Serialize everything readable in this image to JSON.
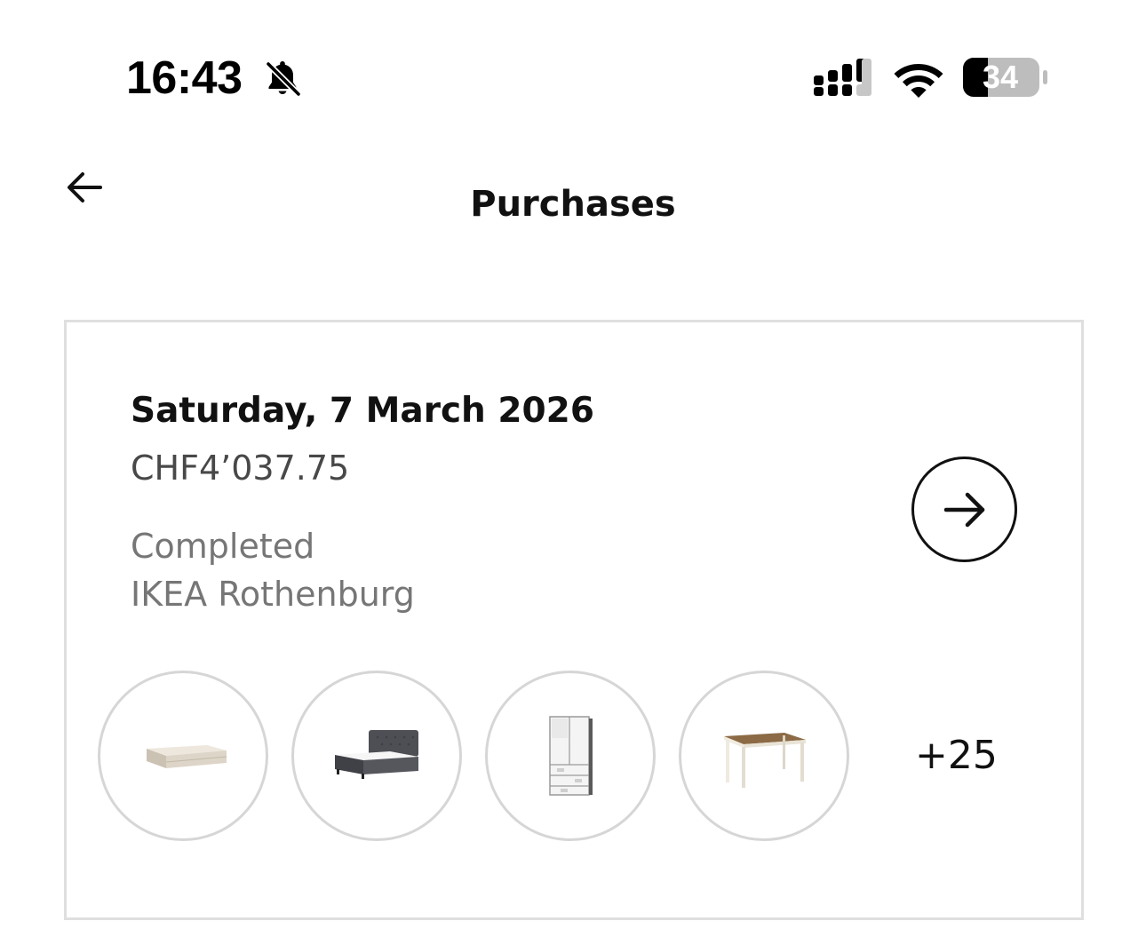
{
  "status_bar": {
    "time": "16:43",
    "silent_icon": "bell-slash-icon",
    "signal_icon": "cellular-signal-icon",
    "wifi_icon": "wifi-icon",
    "battery_level": "34"
  },
  "header": {
    "back_icon": "arrow-left-icon",
    "title": "Purchases"
  },
  "purchases": [
    {
      "date": "Saturday, 7 March 2026",
      "amount": "CHF4’037.75",
      "status": "Completed",
      "store": "IKEA Rothenburg",
      "open_icon": "arrow-right-circle-icon",
      "items": [
        {
          "icon": "mattress-icon"
        },
        {
          "icon": "bed-frame-icon"
        },
        {
          "icon": "wardrobe-icon"
        },
        {
          "icon": "table-icon"
        }
      ],
      "more_items": "+25"
    }
  ],
  "colors": {
    "text_primary": "#111111",
    "text_secondary": "#767676",
    "amount_text": "#484848",
    "card_border": "#dfdfdf",
    "thumb_border": "#d6d6d6"
  }
}
